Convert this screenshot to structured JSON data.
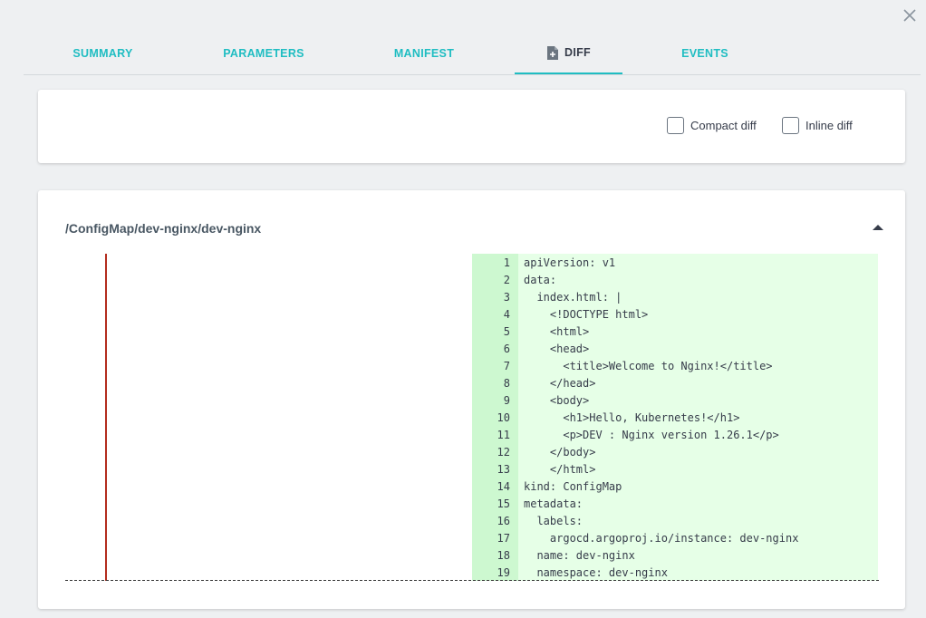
{
  "tabs": [
    {
      "label": "SUMMARY"
    },
    {
      "label": "PARAMETERS"
    },
    {
      "label": "MANIFEST"
    },
    {
      "label": "DIFF"
    },
    {
      "label": "EVENTS"
    }
  ],
  "icons": {
    "close": "close-icon",
    "diff_tab": "file-diff-icon",
    "collapse": "caret-up-icon"
  },
  "options": {
    "compact_label": "Compact diff",
    "inline_label": "Inline diff"
  },
  "resource": {
    "title": "/ConfigMap/dev-nginx/dev-nginx"
  },
  "colors": {
    "accent": "#1fbdc2",
    "added_bg": "#e6ffe7",
    "added_gutter": "#cdf8d0",
    "removed_marker": "#b32c1e"
  },
  "diff_lines": [
    {
      "n": "1",
      "text": "apiVersion: v1"
    },
    {
      "n": "2",
      "text": "data:"
    },
    {
      "n": "3",
      "text": "  index.html: |"
    },
    {
      "n": "4",
      "text": "    <!DOCTYPE html>"
    },
    {
      "n": "5",
      "text": "    <html>"
    },
    {
      "n": "6",
      "text": "    <head>"
    },
    {
      "n": "7",
      "text": "      <title>Welcome to Nginx!</title>"
    },
    {
      "n": "8",
      "text": "    </head>"
    },
    {
      "n": "9",
      "text": "    <body>"
    },
    {
      "n": "10",
      "text": "      <h1>Hello, Kubernetes!</h1>"
    },
    {
      "n": "11",
      "text": "      <p>DEV : Nginx version 1.26.1</p>"
    },
    {
      "n": "12",
      "text": "    </body>"
    },
    {
      "n": "13",
      "text": "    </html>"
    },
    {
      "n": "14",
      "text": "kind: ConfigMap"
    },
    {
      "n": "15",
      "text": "metadata:"
    },
    {
      "n": "16",
      "text": "  labels:"
    },
    {
      "n": "17",
      "text": "    argocd.argoproj.io/instance: dev-nginx"
    },
    {
      "n": "18",
      "text": "  name: dev-nginx"
    },
    {
      "n": "19",
      "text": "  namespace: dev-nginx"
    }
  ]
}
